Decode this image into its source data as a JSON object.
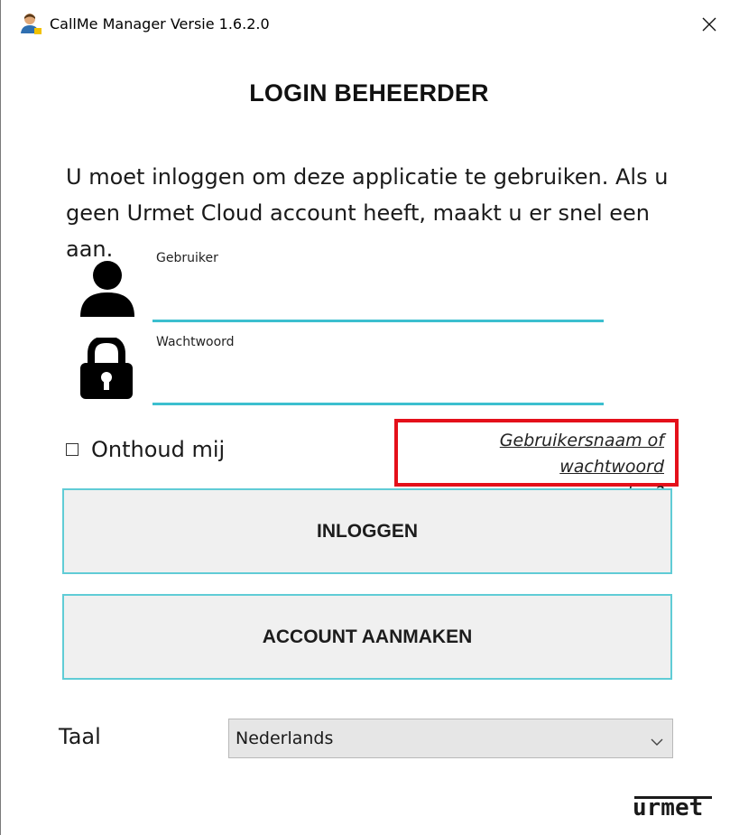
{
  "window": {
    "title": "CallMe Manager Versie 1.6.2.0",
    "close_icon": "close-icon",
    "close_glyph": "✕"
  },
  "heading": "LOGIN BEHEERDER",
  "intro": "U moet inloggen om deze applicatie te gebruiken. Als u geen Urmet Cloud account heeft, maakt u er snel een aan.",
  "form": {
    "user_label": "Gebruiker",
    "user_value": "",
    "user_icon": "user-icon",
    "password_label": "Wachtwoord",
    "password_value": "",
    "password_icon": "lock-icon",
    "underline_color": "#3cbfcf"
  },
  "remember": {
    "checked": false,
    "label": "Onthoud mij"
  },
  "forgot": {
    "line1": "Gebruikersnaam of wachtwoord",
    "line2": "vergeten?",
    "highlight_color": "#e4101a"
  },
  "buttons": {
    "login": "INLOGGEN",
    "create_account": "ACCOUNT AANMAKEN",
    "border_color": "#60ccd6"
  },
  "language": {
    "label": "Taal",
    "selected": "Nederlands",
    "chevron_icon": "chevron-down-icon"
  },
  "logo": "urmet"
}
